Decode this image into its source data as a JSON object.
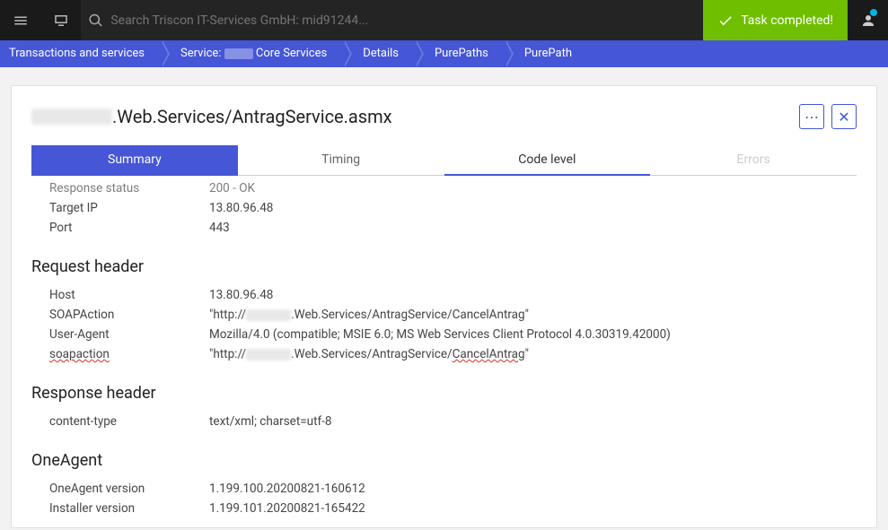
{
  "topbar": {
    "search_placeholder": "Search Triscon IT-Services GmbH: mid91244...",
    "task_completed": "Task completed!"
  },
  "breadcrumb": {
    "items": [
      {
        "label": "Transactions and services"
      },
      {
        "label_prefix": "Service: ",
        "label_suffix": " Core Services",
        "has_redact": true
      },
      {
        "label": "Details"
      },
      {
        "label": "PurePaths"
      },
      {
        "label": "PurePath"
      }
    ]
  },
  "page": {
    "title_suffix": ".Web.Services/AntragService.asmx"
  },
  "tabs": {
    "summary": "Summary",
    "timing": "Timing",
    "codelevel": "Code level",
    "errors": "Errors"
  },
  "top_kv": {
    "response_status_k": "Response status",
    "response_status_v": "200 - OK",
    "target_ip_k": "Target IP",
    "target_ip_v": "13.80.96.48",
    "port_k": "Port",
    "port_v": "443"
  },
  "sections": {
    "request_header": "Request header",
    "response_header": "Response header",
    "oneagent": "OneAgent"
  },
  "request_header": {
    "host_k": "Host",
    "host_v": "13.80.96.48",
    "soap_k": "SOAPAction",
    "soap_pre": "\"http://",
    "soap_post": ".Web.Services/AntragService/CancelAntrag\"",
    "ua_k": "User-Agent",
    "ua_v": "Mozilla/4.0 (compatible; MSIE 6.0; MS Web Services Client Protocol 4.0.30319.42000)",
    "soap2_k": "soapaction",
    "soap2_pre": "\"http://",
    "soap2_mid": ".Web.Services/AntragService/",
    "soap2_cancel": "CancelAntrag",
    "soap2_end": "\""
  },
  "response_header": {
    "ct_k": "content-type",
    "ct_v": "text/xml; charset=utf-8"
  },
  "oneagent": {
    "ver_k": "OneAgent version",
    "ver_v": "1.199.100.20200821-160612",
    "inst_k": "Installer version",
    "inst_v": "1.199.101.20200821-165422"
  }
}
